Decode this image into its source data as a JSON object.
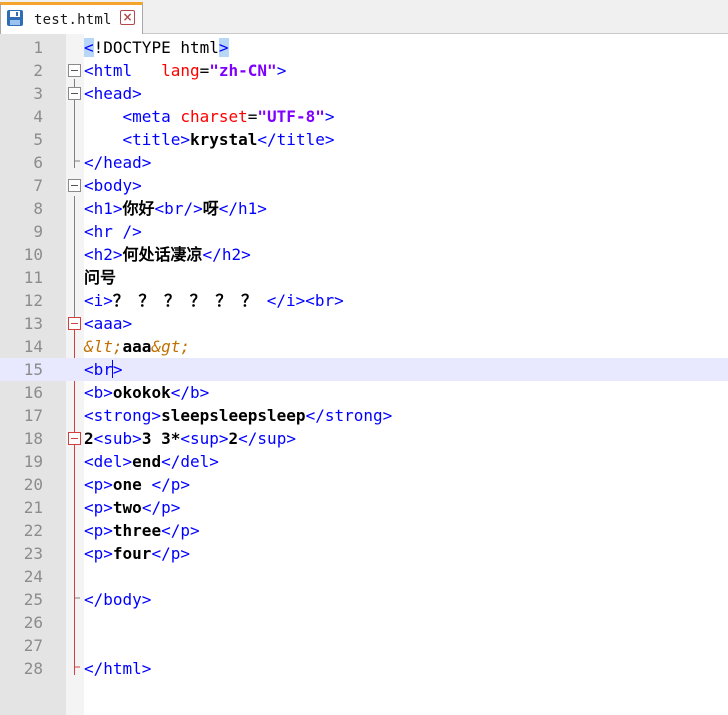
{
  "tab": {
    "title": "test.html",
    "save_icon": "floppy-disk-icon",
    "close_icon": "close-x-icon"
  },
  "colors": {
    "tag": "#0000ff",
    "attribute": "#ff0000",
    "attribute_value": "#8000ff",
    "text": "#000000",
    "entity": "#c07000",
    "fold_marker_red": "#d04040",
    "current_line": "#e8e8ff",
    "tab_accent": "#f4a42a"
  },
  "editor": {
    "current_line": 15,
    "lines": [
      {
        "n": "1",
        "fold": "",
        "segments": [
          [
            "tag-hl",
            "<"
          ],
          [
            "doc",
            "!DOCTYPE html"
          ],
          [
            "tag-hl",
            ">"
          ]
        ]
      },
      {
        "n": "2",
        "fold": "box",
        "segments": [
          [
            "tag",
            "<html"
          ],
          [
            "doc",
            "   "
          ],
          [
            "attr",
            "lang"
          ],
          [
            "eq",
            "="
          ],
          [
            "val",
            "\"zh-CN\""
          ],
          [
            "tag",
            ">"
          ]
        ]
      },
      {
        "n": "3",
        "fold": "box",
        "segments": [
          [
            "tag",
            "<head>"
          ]
        ]
      },
      {
        "n": "4",
        "fold": "",
        "segments": [
          [
            "doc",
            "    "
          ],
          [
            "tag",
            "<meta "
          ],
          [
            "attr",
            "charset"
          ],
          [
            "eq",
            "="
          ],
          [
            "val",
            "\"UTF-8\""
          ],
          [
            "tag",
            ">"
          ]
        ]
      },
      {
        "n": "5",
        "fold": "",
        "segments": [
          [
            "doc",
            "    "
          ],
          [
            "tag",
            "<title>"
          ],
          [
            "txt",
            "krystal"
          ],
          [
            "tag",
            "</title>"
          ]
        ]
      },
      {
        "n": "6",
        "fold": "",
        "segments": [
          [
            "tag",
            "</head>"
          ]
        ]
      },
      {
        "n": "7",
        "fold": "box",
        "segments": [
          [
            "tag",
            "<body>"
          ]
        ]
      },
      {
        "n": "8",
        "fold": "",
        "segments": [
          [
            "tag",
            "<h1>"
          ],
          [
            "txt",
            "你好"
          ],
          [
            "tag",
            "<br/>"
          ],
          [
            "txt",
            "呀"
          ],
          [
            "tag",
            "</h1>"
          ]
        ]
      },
      {
        "n": "9",
        "fold": "",
        "segments": [
          [
            "tag",
            "<hr />"
          ]
        ]
      },
      {
        "n": "10",
        "fold": "",
        "segments": [
          [
            "tag",
            "<h2>"
          ],
          [
            "txt",
            "何处话凄凉"
          ],
          [
            "tag",
            "</h2>"
          ]
        ]
      },
      {
        "n": "11",
        "fold": "",
        "segments": [
          [
            "txt",
            "问号"
          ]
        ]
      },
      {
        "n": "12",
        "fold": "",
        "segments": [
          [
            "tag",
            "<i>"
          ],
          [
            "txt",
            "？ ？ ？ ？ ？ ？ "
          ],
          [
            "tag",
            "</i><br>"
          ]
        ]
      },
      {
        "n": "13",
        "fold": "red",
        "segments": [
          [
            "tag",
            "<aaa>"
          ]
        ]
      },
      {
        "n": "14",
        "fold": "",
        "segments": [
          [
            "ent",
            "&lt;"
          ],
          [
            "txt",
            "aaa"
          ],
          [
            "ent",
            "&gt;"
          ]
        ]
      },
      {
        "n": "15",
        "fold": "",
        "segments": [
          [
            "tag",
            "<br"
          ],
          [
            "caret",
            ""
          ],
          [
            "tag",
            ">"
          ]
        ]
      },
      {
        "n": "16",
        "fold": "",
        "segments": [
          [
            "tag",
            "<b>"
          ],
          [
            "txt",
            "okokok"
          ],
          [
            "tag",
            "</b>"
          ]
        ]
      },
      {
        "n": "17",
        "fold": "",
        "segments": [
          [
            "tag",
            "<strong>"
          ],
          [
            "txt",
            "sleepsleepsleep"
          ],
          [
            "tag",
            "</strong>"
          ]
        ]
      },
      {
        "n": "18",
        "fold": "red",
        "segments": [
          [
            "txt",
            "2"
          ],
          [
            "tag",
            "<sub>"
          ],
          [
            "txt",
            "3 3*"
          ],
          [
            "tag",
            "<sup>"
          ],
          [
            "txt",
            "2"
          ],
          [
            "tag",
            "</sup>"
          ]
        ]
      },
      {
        "n": "19",
        "fold": "",
        "segments": [
          [
            "tag",
            "<del>"
          ],
          [
            "txt",
            "end"
          ],
          [
            "tag",
            "</del>"
          ]
        ]
      },
      {
        "n": "20",
        "fold": "",
        "segments": [
          [
            "tag",
            "<p>"
          ],
          [
            "txt",
            "one "
          ],
          [
            "tag",
            "</p>"
          ]
        ]
      },
      {
        "n": "21",
        "fold": "",
        "segments": [
          [
            "tag",
            "<p>"
          ],
          [
            "txt",
            "two"
          ],
          [
            "tag",
            "</p>"
          ]
        ]
      },
      {
        "n": "22",
        "fold": "",
        "segments": [
          [
            "tag",
            "<p>"
          ],
          [
            "txt",
            "three"
          ],
          [
            "tag",
            "</p>"
          ]
        ]
      },
      {
        "n": "23",
        "fold": "",
        "segments": [
          [
            "tag",
            "<p>"
          ],
          [
            "txt",
            "four"
          ],
          [
            "tag",
            "</p>"
          ]
        ]
      },
      {
        "n": "24",
        "fold": "",
        "segments": []
      },
      {
        "n": "25",
        "fold": "",
        "segments": [
          [
            "tag",
            "</body>"
          ]
        ]
      },
      {
        "n": "26",
        "fold": "",
        "segments": []
      },
      {
        "n": "27",
        "fold": "",
        "segments": []
      },
      {
        "n": "28",
        "fold": "",
        "segments": [
          [
            "tag",
            "</html>"
          ]
        ]
      }
    ]
  }
}
